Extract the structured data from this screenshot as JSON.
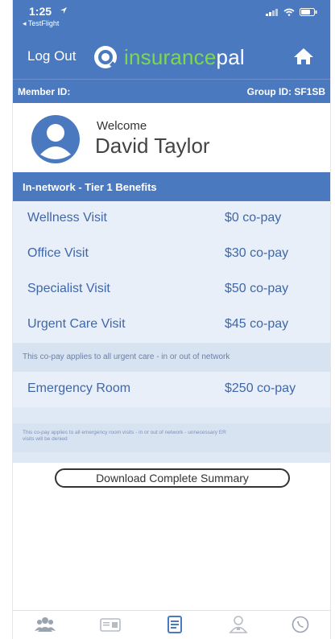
{
  "status": {
    "time": "1:25",
    "back_label": "◂ TestFlight"
  },
  "header": {
    "logout_label": "Log Out",
    "logo_part1": "insurance",
    "logo_part2": "pal"
  },
  "member": {
    "member_label": "Member ID:",
    "group_label": "Group ID: SF1SB"
  },
  "welcome": {
    "greeting": "Welcome",
    "name": "David Taylor"
  },
  "tier_title": "In-network - Tier 1 Benefits",
  "benefits": [
    {
      "name": "Wellness Visit",
      "value": "$0 co-pay"
    },
    {
      "name": "Office Visit",
      "value": "$30 co-pay"
    },
    {
      "name": "Specialist Visit",
      "value": "$50 co-pay"
    },
    {
      "name": "Urgent Care Visit",
      "value": "$45 co-pay"
    }
  ],
  "urgent_note": "This co-pay applies to all urgent care - in or out of network",
  "emergency": {
    "name": "Emergency Room",
    "value": "$250 co-pay"
  },
  "emergency_note": "This co-pay applies to all emergency room visits - in or out of network - unnecessary ER visits will be denied",
  "download_label": "Download Complete Summary",
  "colors": {
    "primary": "#4a79bf",
    "accent": "#7cd94a",
    "text_blue": "#3f67a8"
  },
  "tabs": [
    "group-icon",
    "id-card-icon",
    "document-icon",
    "doctor-icon",
    "phone-icon"
  ]
}
